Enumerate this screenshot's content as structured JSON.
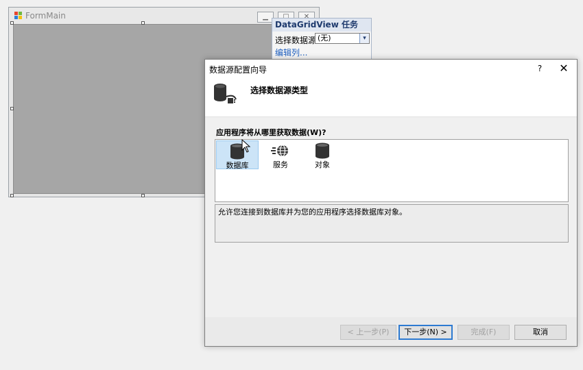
{
  "form": {
    "title": "FormMain",
    "minimize_glyph": "▁",
    "maximize_glyph": "□",
    "close_glyph": "✕",
    "smart_tag_glyph": "◂"
  },
  "smart_panel": {
    "header": "DataGridView 任务",
    "datasource_label": "选择数据源:",
    "datasource_value": "(无)",
    "dropdown_glyph": "▾",
    "edit_columns_link": "编辑列..."
  },
  "dialog": {
    "title": "数据源配置向导",
    "help_label": "?",
    "close_glyph": "✕",
    "header_title": "选择数据源类型",
    "question": "应用程序将从哪里获取数据(W)?",
    "types": [
      {
        "label": "数据库",
        "icon": "database-icon",
        "selected": true
      },
      {
        "label": "服务",
        "icon": "service-globe-icon",
        "selected": false
      },
      {
        "label": "对象",
        "icon": "object-icon",
        "selected": false
      }
    ],
    "description": "允许您连接到数据库并为您的应用程序选择数据库对象。",
    "buttons": {
      "back": "< 上一步(P)",
      "next": "下一步(N) >",
      "finish": "完成(F)",
      "cancel": "取消"
    }
  },
  "colors": {
    "selection": "#cce4f7",
    "link": "#1e5fbf",
    "panel_header": "#dfe6f1",
    "primary_border": "#2d7ad1"
  }
}
